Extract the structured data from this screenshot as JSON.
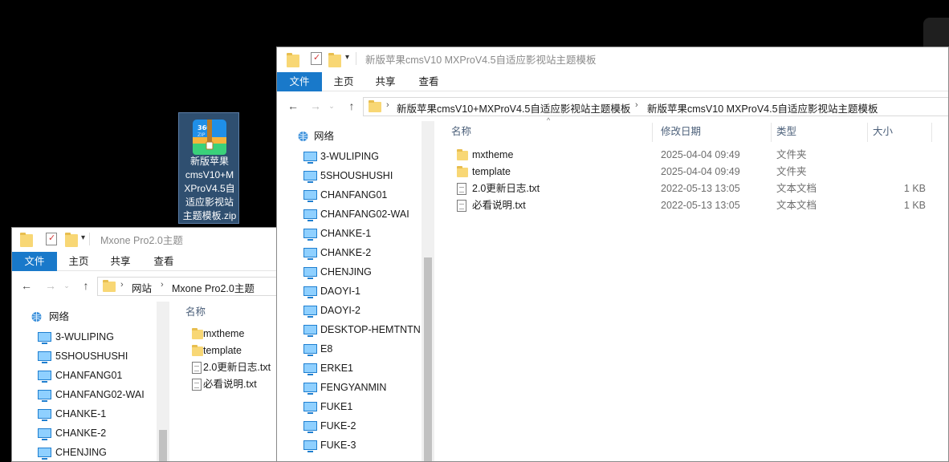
{
  "desktop": {
    "icon_label": "新版苹果cmsV10+MXProV4.5自适应影视站主题模板.zip",
    "icon_label_lines": [
      "新版苹果",
      "cmsV10+M",
      "XProV4.5自",
      "适应影视站",
      "主题模板.zip"
    ]
  },
  "window_main": {
    "title": "新版苹果cmsV10 MXProV4.5自适应影视站主题模板",
    "ribbon_tabs": [
      "文件",
      "主页",
      "共享",
      "查看"
    ],
    "breadcrumb": [
      "新版苹果cmsV10+MXProV4.5自适应影视站主题模板",
      "新版苹果cmsV10 MXProV4.5自适应影视站主题模板"
    ],
    "nav_root": "网络",
    "nav_items": [
      "3-WULIPING",
      "5SHOUSHUSHI",
      "CHANFANG01",
      "CHANFANG02-WAI",
      "CHANKE-1",
      "CHANKE-2",
      "CHENJING",
      "DAOYI-1",
      "DAOYI-2",
      "DESKTOP-HEMTNTN",
      "E8",
      "ERKE1",
      "FENGYANMIN",
      "FUKE1",
      "FUKE-2",
      "FUKE-3"
    ],
    "columns": {
      "name": "名称",
      "modified": "修改日期",
      "type": "类型",
      "size": "大小"
    },
    "files": [
      {
        "name": "mxtheme",
        "modified": "2025-04-04 09:49",
        "type": "文件夹",
        "size": "",
        "icon": "folder-icon"
      },
      {
        "name": "template",
        "modified": "2025-04-04 09:49",
        "type": "文件夹",
        "size": "",
        "icon": "folder-icon"
      },
      {
        "name": "2.0更新日志.txt",
        "modified": "2022-05-13 13:05",
        "type": "文本文档",
        "size": "1 KB",
        "icon": "text-file-icon"
      },
      {
        "name": "必看说明.txt",
        "modified": "2022-05-13 13:05",
        "type": "文本文档",
        "size": "1 KB",
        "icon": "text-file-icon"
      }
    ]
  },
  "window_back": {
    "title": "Mxone Pro2.0主题",
    "ribbon_tabs": [
      "文件",
      "主页",
      "共享",
      "查看"
    ],
    "breadcrumb": [
      "网站",
      "Mxone Pro2.0主题"
    ],
    "nav_root": "网络",
    "nav_items": [
      "3-WULIPING",
      "5SHOUSHUSHI",
      "CHANFANG01",
      "CHANFANG02-WAI",
      "CHANKE-1",
      "CHANKE-2",
      "CHENJING"
    ],
    "columns": {
      "name": "名称"
    },
    "files": [
      {
        "name": "mxtheme",
        "icon": "folder-icon"
      },
      {
        "name": "template",
        "icon": "folder-icon"
      },
      {
        "name": "2.0更新日志.txt",
        "icon": "text-file-icon"
      },
      {
        "name": "必看说明.txt",
        "icon": "text-file-icon"
      }
    ]
  },
  "colors": {
    "file_tab": "#1979ca",
    "desktop": "#000000",
    "folder": "#f8d775"
  }
}
